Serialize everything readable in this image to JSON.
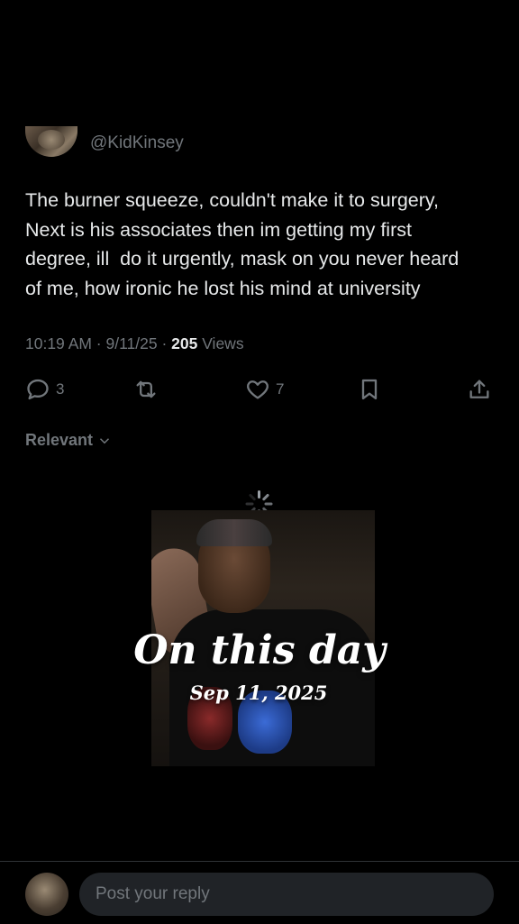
{
  "post": {
    "handle": "@KidKinsey",
    "text": "The burner squeeze, couldn't make it to surgery,\nNext is his associates then im getting my first\ndegree, ill  do it urgently, mask on you never heard\nof me, how ironic he lost his mind at university",
    "timestamp": "10:19 AM · 9/11/25 · ",
    "views_count": "205",
    "views_label": " Views"
  },
  "actions": {
    "reply_count": "3",
    "like_count": "7",
    "icons": [
      "reply-icon",
      "retweet-icon",
      "heart-icon",
      "bookmark-icon",
      "share-icon"
    ]
  },
  "replies_sort": {
    "label": "Relevant"
  },
  "memory_overlay": {
    "title": "On this day",
    "date": "Sep 11, 2025"
  },
  "reply_bar": {
    "placeholder": "Post your reply"
  },
  "colors": {
    "background": "#000000",
    "text_primary": "#e7e9ea",
    "text_secondary": "#71767b",
    "input_bg": "#202327"
  }
}
